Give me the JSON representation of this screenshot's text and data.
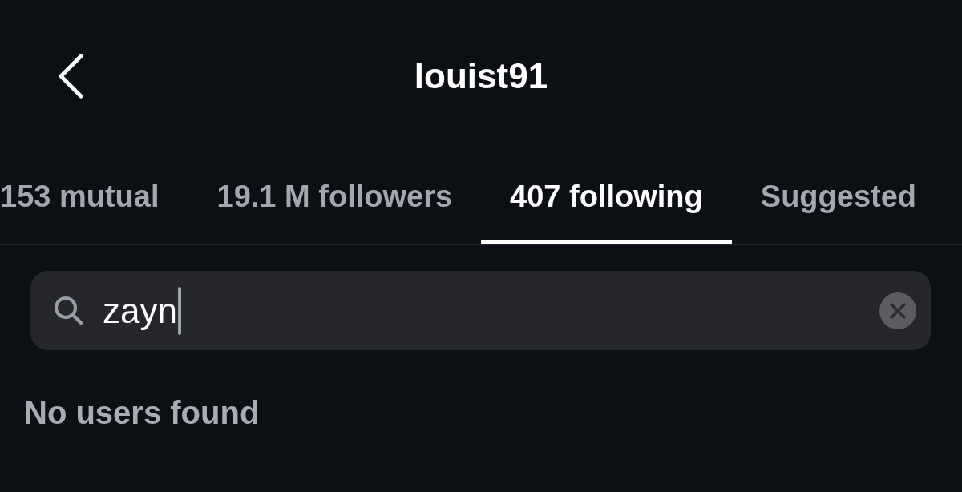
{
  "header": {
    "title": "louist91"
  },
  "tabs": [
    {
      "label": "153 mutual",
      "selected": false
    },
    {
      "label": "19.1 M followers",
      "selected": false
    },
    {
      "label": "407 following",
      "selected": true
    },
    {
      "label": "Suggested",
      "selected": false
    }
  ],
  "search": {
    "value": "zayn",
    "focused": true
  },
  "empty_state": {
    "message": "No users found"
  }
}
